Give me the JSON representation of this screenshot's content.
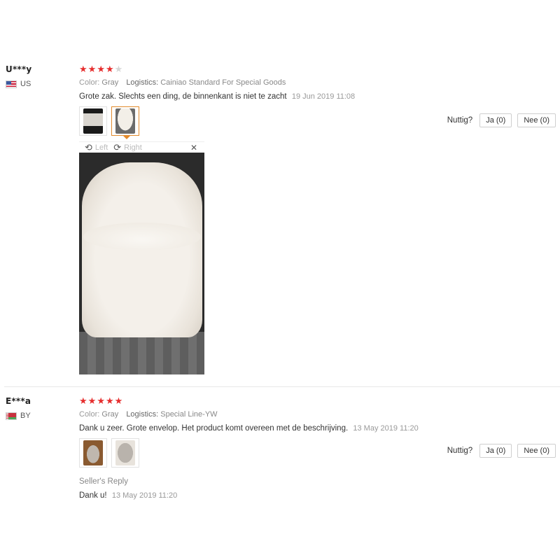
{
  "labels": {
    "color": "Color:",
    "logistics": "Logistics:",
    "helpful": "Nuttig?",
    "seller_reply": "Seller's Reply",
    "rotate_left": "Left",
    "rotate_right": "Right"
  },
  "icons": {
    "rotate_left": "rotate-left-icon",
    "rotate_right": "rotate-right-icon",
    "close": "close-icon"
  },
  "colors": {
    "star_on": "#e62e2e",
    "star_off": "#d6d6d6",
    "thumb_active": "#e28a2c"
  },
  "reviews": [
    {
      "user": "U***y",
      "country": "US",
      "rating": 4,
      "color": "Gray",
      "logistics": "Cainiao Standard For Special Goods",
      "comment": "Grote zak. Slechts een ding, de binnenkant is niet te zacht",
      "date": "19 Jun 2019 11:08",
      "yes_label": "Ja (0)",
      "no_label": "Nee (0)"
    },
    {
      "user": "E***a",
      "country": "BY",
      "rating": 5,
      "color": "Gray",
      "logistics": "Special Line-YW",
      "comment": "Dank u zeer. Grote envelop. Het product komt overeen met de beschrijving.",
      "date": "13 May 2019 11:20",
      "yes_label": "Ja (0)",
      "no_label": "Nee (0)",
      "reply": {
        "text": "Dank u!",
        "date": "13 May 2019 11:20"
      }
    }
  ]
}
